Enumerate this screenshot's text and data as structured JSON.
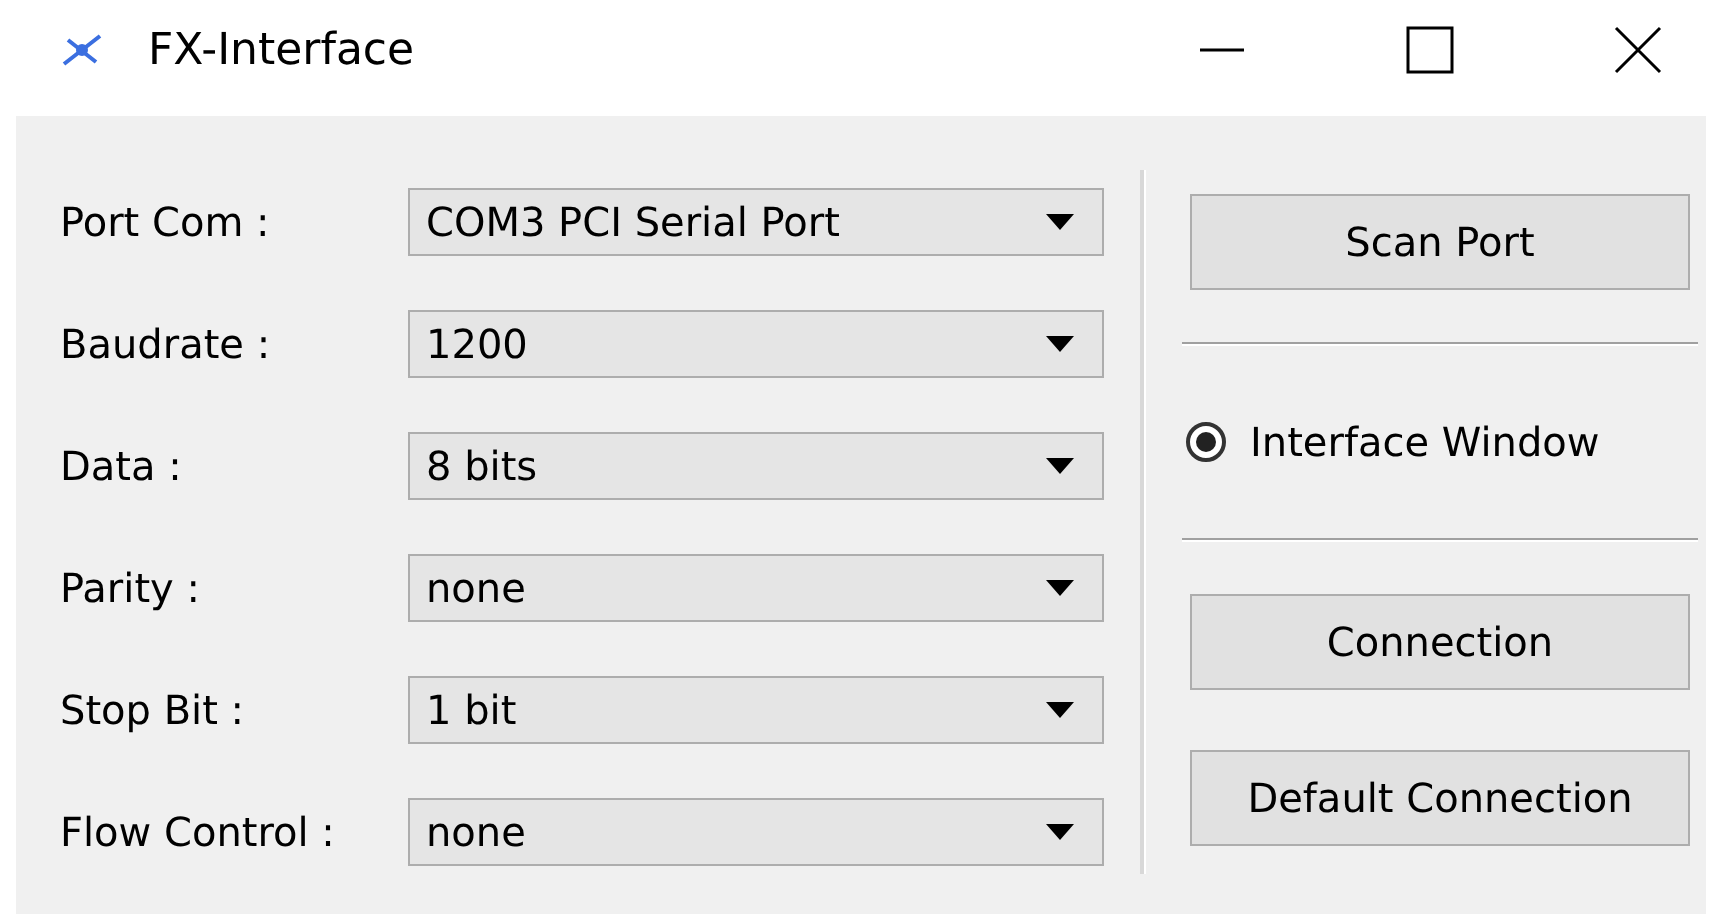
{
  "window": {
    "title": "FX-Interface"
  },
  "fields": [
    {
      "label": "Port Com :",
      "value": "COM3 PCI Serial Port"
    },
    {
      "label": "Baudrate :",
      "value": "1200"
    },
    {
      "label": "Data :",
      "value": "8 bits"
    },
    {
      "label": "Parity :",
      "value": "none"
    },
    {
      "label": "Stop Bit :",
      "value": "1 bit"
    },
    {
      "label": "Flow Control :",
      "value": "none"
    }
  ],
  "right_panel": [
    {
      "kind": "button",
      "label": "Scan Port"
    },
    {
      "kind": "separator"
    },
    {
      "kind": "radio",
      "label": "Interface Window",
      "selected": true
    },
    {
      "kind": "separator"
    },
    {
      "kind": "button",
      "label": "Connection"
    },
    {
      "kind": "button",
      "label": "Default Connection"
    }
  ]
}
